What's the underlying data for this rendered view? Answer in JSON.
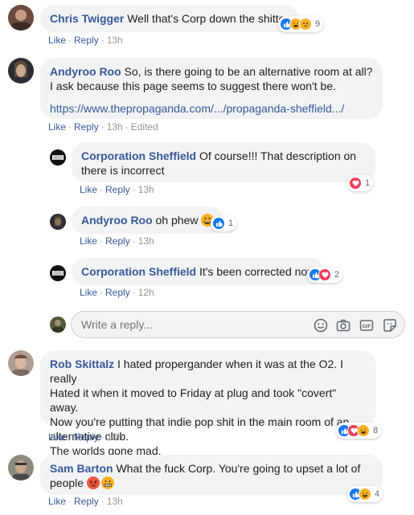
{
  "comments": [
    {
      "author": "Chris Twigger",
      "text": " Well that's Corp down the shitter",
      "actions": {
        "like": "Like",
        "reply": "Reply",
        "time": "13h"
      },
      "reactions": {
        "count": "9",
        "types": [
          "like",
          "haha",
          "sad"
        ]
      }
    },
    {
      "author": "Andyroo Roo",
      "text": " So, is there going to be an alternative room at all? I ask because this page seems to suggest there won't be.",
      "link": "https://www.thepropaganda.com/.../propaganda-sheffield.../",
      "actions": {
        "like": "Like",
        "reply": "Reply",
        "time": "13h",
        "edited": "Edited"
      }
    },
    {
      "author": "Corporation Sheffield",
      "text": " Of course!!! That description on there is incorrect",
      "actions": {
        "like": "Like",
        "reply": "Reply",
        "time": "13h"
      },
      "reactions": {
        "count": "1",
        "types": [
          "love"
        ]
      }
    },
    {
      "author": "Andyroo Roo",
      "text": " oh phew ",
      "emoji": "grinning",
      "actions": {
        "like": "Like",
        "reply": "Reply",
        "time": "13h"
      },
      "reactions": {
        "count": "1",
        "types": [
          "like"
        ]
      }
    },
    {
      "author": "Corporation Sheffield",
      "text": " It's been corrected now",
      "actions": {
        "like": "Like",
        "reply": "Reply",
        "time": "12h"
      },
      "reactions": {
        "count": "2",
        "types": [
          "like",
          "love"
        ]
      }
    },
    {
      "author": "Rob Skittalz",
      "text_lines": [
        " I hated propergander when it was at the O2. I really",
        "Hated it when it moved to Friday at plug and took \"covert\" away.",
        "Now you're putting that indie pop shit in the main room of an",
        "alternative club.",
        "The worlds gone mad."
      ],
      "actions": {
        "like": "Like",
        "reply": "Reply",
        "time": "13h"
      },
      "reactions": {
        "count": "8",
        "types": [
          "like",
          "love",
          "haha"
        ]
      }
    },
    {
      "author": "Sam Barton",
      "text": " What the fuck Corp. You're going to upset a lot of",
      "text2": "people ",
      "emojis": [
        "angry",
        "grimacing"
      ],
      "actions": {
        "like": "Like",
        "reply": "Reply",
        "time": "13h"
      },
      "reactions": {
        "count": "4",
        "types": [
          "like",
          "haha"
        ]
      }
    }
  ],
  "reply_box": {
    "placeholder": "Write a reply...",
    "tools": [
      "emoji-icon",
      "camera-icon",
      "gif-icon",
      "sticker-icon"
    ]
  },
  "colors": {
    "author": "#385898",
    "bubble": "#f2f3f5",
    "meta": "#90949c",
    "like": "#1877f2",
    "love": "#f33e58",
    "haha": "#f7b125"
  }
}
